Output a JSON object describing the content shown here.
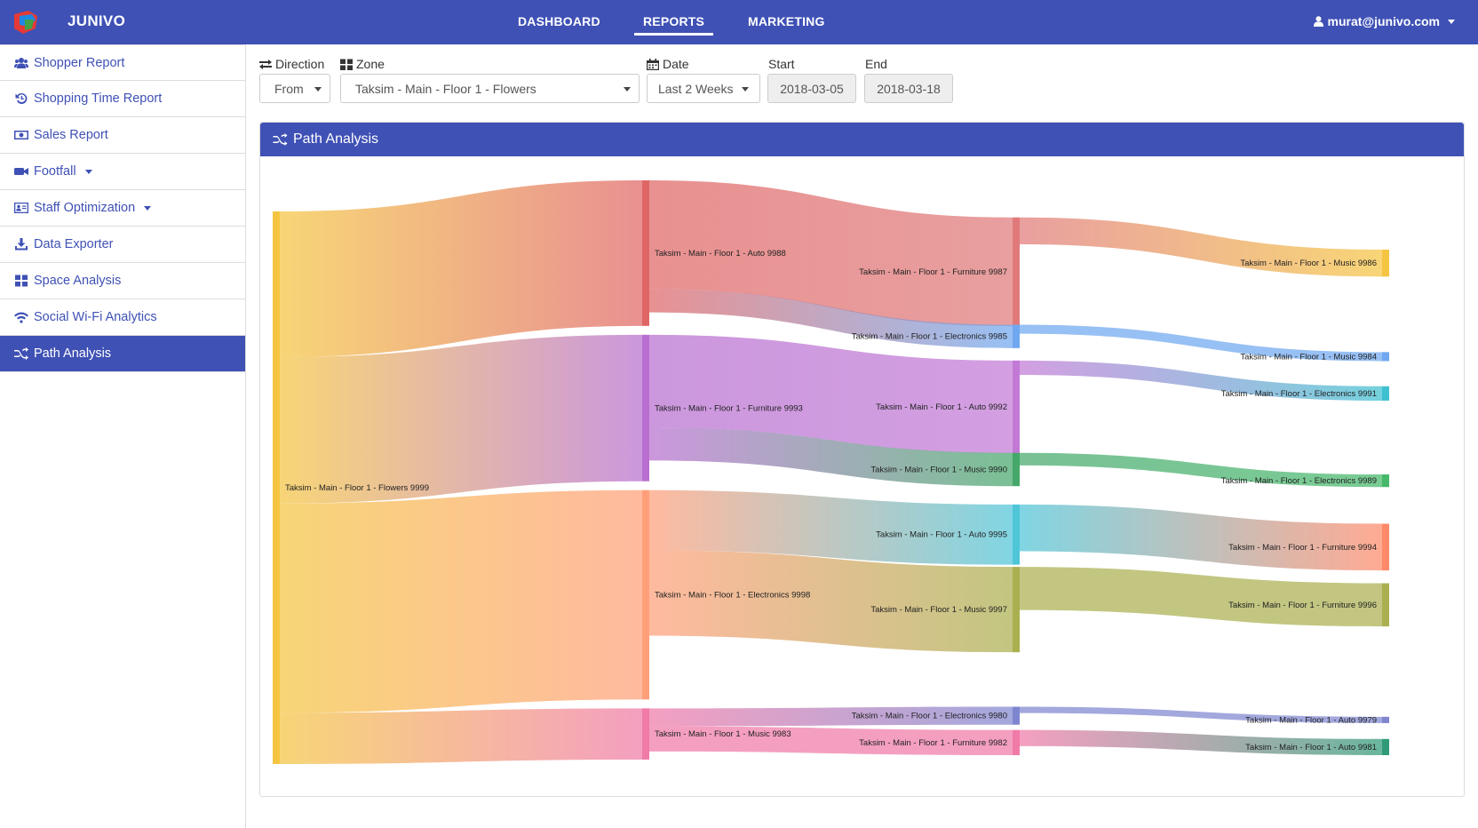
{
  "header": {
    "brand": "JUNIVO",
    "nav": [
      {
        "label": "DASHBOARD"
      },
      {
        "label": "REPORTS"
      },
      {
        "label": "MARKETING"
      }
    ],
    "user": "murat@junivo.com"
  },
  "sidebar": {
    "items": [
      {
        "label": "Shopper Report",
        "icon": "users-icon"
      },
      {
        "label": "Shopping Time Report",
        "icon": "history-icon"
      },
      {
        "label": "Sales Report",
        "icon": "money-icon"
      },
      {
        "label": "Footfall",
        "icon": "video-camera-icon"
      },
      {
        "label": "Staff Optimization",
        "icon": "id-card-icon"
      },
      {
        "label": "Data Exporter",
        "icon": "download-icon"
      },
      {
        "label": "Space Analysis",
        "icon": "grid-icon"
      },
      {
        "label": "Social Wi-Fi Analytics",
        "icon": "wifi-icon"
      },
      {
        "label": "Path Analysis",
        "icon": "random-icon"
      }
    ]
  },
  "filters": {
    "direction_label": "Direction",
    "direction_value": "From",
    "zone_label": "Zone",
    "zone_value": "Taksim - Main - Floor 1 - Flowers",
    "date_label": "Date",
    "date_value": "Last 2 Weeks",
    "start_label": "Start",
    "start_value": "2018-03-05",
    "end_label": "End",
    "end_value": "2018-03-18"
  },
  "panel": {
    "title": "Path Analysis"
  },
  "colors": {
    "primary": "#3f51b5"
  },
  "chart_data": {
    "type": "sankey",
    "nodes": [
      {
        "id": "flowers9999",
        "label": "Taksim - Main - Floor 1 - Flowers 9999",
        "color": "#f5c542",
        "level": 0
      },
      {
        "id": "auto9988",
        "label": "Taksim - Main - Floor 1 - Auto 9988",
        "color": "#e06666",
        "level": 1
      },
      {
        "id": "furniture9993",
        "label": "Taksim - Main - Floor 1 - Furniture 9993",
        "color": "#b86fd0",
        "level": 1
      },
      {
        "id": "electronics9998",
        "label": "Taksim - Main - Floor 1 - Electronics 9998",
        "color": "#ff9f7a",
        "level": 1
      },
      {
        "id": "music9983",
        "label": "Taksim - Main - Floor 1 - Music 9983",
        "color": "#f07aa8",
        "level": 1
      },
      {
        "id": "furniture9987",
        "label": "Taksim - Main - Floor 1 - Furniture 9987",
        "color": "#e07a7a",
        "level": 2
      },
      {
        "id": "electronics9985",
        "label": "Taksim - Main - Floor 1 - Electronics 9985",
        "color": "#6fa8f0",
        "level": 2
      },
      {
        "id": "auto9992",
        "label": "Taksim - Main - Floor 1 - Auto 9992",
        "color": "#c27ad6",
        "level": 2
      },
      {
        "id": "music9990",
        "label": "Taksim - Main - Floor 1 - Music 9990",
        "color": "#45a86a",
        "level": 2
      },
      {
        "id": "auto9995",
        "label": "Taksim - Main - Floor 1 - Auto 9995",
        "color": "#4fc5d8",
        "level": 2
      },
      {
        "id": "music9997",
        "label": "Taksim - Main - Floor 1 - Music 9997",
        "color": "#aab050",
        "level": 2
      },
      {
        "id": "electronics9980",
        "label": "Taksim - Main - Floor 1 - Electronics 9980",
        "color": "#7f86d0",
        "level": 2
      },
      {
        "id": "furniture9982",
        "label": "Taksim - Main - Floor 1 - Furniture 9982",
        "color": "#f07aa8",
        "level": 2
      },
      {
        "id": "music9986",
        "label": "Taksim - Main - Floor 1 - Music 9986",
        "color": "#f5c542",
        "level": 3
      },
      {
        "id": "music9984",
        "label": "Taksim - Main - Floor 1 - Music 9984",
        "color": "#6fa8f0",
        "level": 3
      },
      {
        "id": "electronics9991",
        "label": "Taksim - Main - Floor 1 - Electronics 9991",
        "color": "#3fc0d0",
        "level": 3
      },
      {
        "id": "electronics9989",
        "label": "Taksim - Main - Floor 1 - Electronics 9989",
        "color": "#45b86a",
        "level": 3
      },
      {
        "id": "furniture9994",
        "label": "Taksim - Main - Floor 1 - Furniture 9994",
        "color": "#ff8a6a",
        "level": 3
      },
      {
        "id": "furniture9996",
        "label": "Taksim - Main - Floor 1 - Furniture 9996",
        "color": "#aab050",
        "level": 3
      },
      {
        "id": "auto9979",
        "label": "Taksim - Main - Floor 1 - Auto 9979",
        "color": "#7f86d0",
        "level": 3
      },
      {
        "id": "auto9981",
        "label": "Taksim - Main - Floor 1 - Auto 9981",
        "color": "#2f9a78",
        "level": 3
      }
    ],
    "links": [
      {
        "source": "flowers9999",
        "target": "auto9988",
        "value": 162
      },
      {
        "source": "flowers9999",
        "target": "furniture9993",
        "value": 163
      },
      {
        "source": "flowers9999",
        "target": "electronics9998",
        "value": 233
      },
      {
        "source": "flowers9999",
        "target": "music9983",
        "value": 57
      },
      {
        "source": "auto9988",
        "target": "furniture9987",
        "value": 121
      },
      {
        "source": "auto9988",
        "target": "electronics9985",
        "value": 26
      },
      {
        "source": "furniture9993",
        "target": "auto9992",
        "value": 103
      },
      {
        "source": "furniture9993",
        "target": "music9990",
        "value": 37
      },
      {
        "source": "electronics9998",
        "target": "auto9995",
        "value": 67
      },
      {
        "source": "electronics9998",
        "target": "music9997",
        "value": 95
      },
      {
        "source": "music9983",
        "target": "electronics9980",
        "value": 20
      },
      {
        "source": "music9983",
        "target": "furniture9982",
        "value": 28
      },
      {
        "source": "furniture9987",
        "target": "music9986",
        "value": 30
      },
      {
        "source": "electronics9985",
        "target": "music9984",
        "value": 10
      },
      {
        "source": "auto9992",
        "target": "electronics9991",
        "value": 16
      },
      {
        "source": "music9990",
        "target": "electronics9989",
        "value": 14
      },
      {
        "source": "auto9995",
        "target": "furniture9994",
        "value": 52
      },
      {
        "source": "music9997",
        "target": "furniture9996",
        "value": 48
      },
      {
        "source": "electronics9980",
        "target": "auto9979",
        "value": 7
      },
      {
        "source": "furniture9982",
        "target": "auto9981",
        "value": 18
      }
    ]
  }
}
